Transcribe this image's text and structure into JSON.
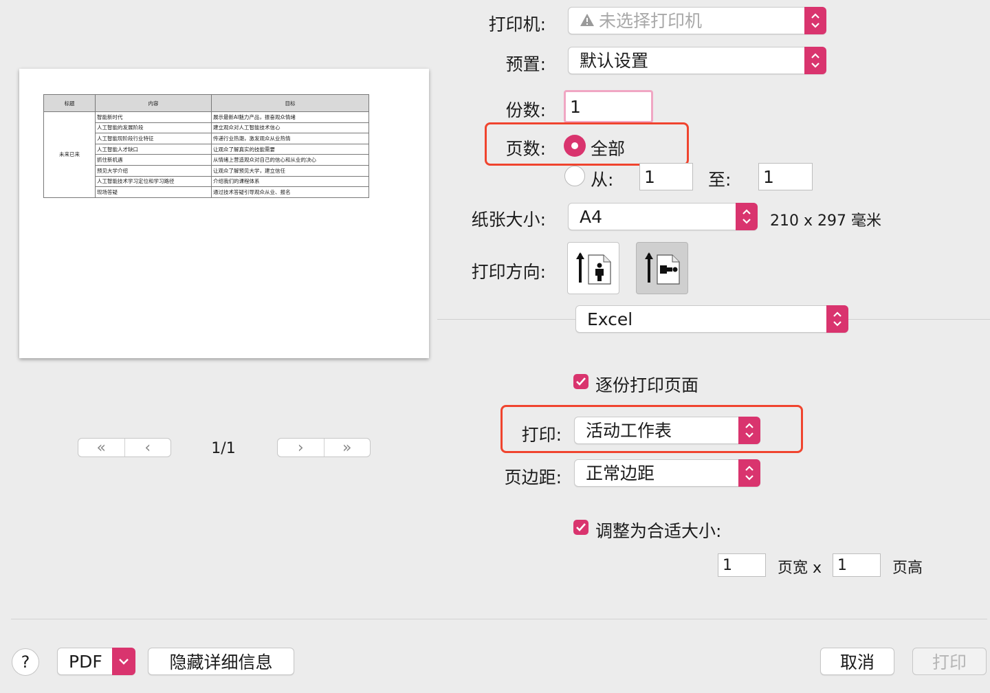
{
  "printer": {
    "label": "打印机:",
    "value": "未选择打印机"
  },
  "preset": {
    "label": "预置:",
    "value": "默认设置"
  },
  "copies": {
    "label": "份数:",
    "value": "1"
  },
  "pages": {
    "label": "页数:",
    "all_label": "全部",
    "from_label": "从:",
    "from_value": "1",
    "to_label": "至:",
    "to_value": "1"
  },
  "paper": {
    "label": "纸张大小:",
    "value": "A4",
    "dims": "210 x 297 毫米"
  },
  "orientation": {
    "label": "打印方向:",
    "selected": "portrait"
  },
  "app_menu": {
    "value": "Excel"
  },
  "collate": {
    "label": "逐份打印页面",
    "checked": true
  },
  "print_what": {
    "label": "打印:",
    "value": "活动工作表"
  },
  "margins": {
    "label": "页边距:",
    "value": "正常边距"
  },
  "fit": {
    "label": "调整为合适大小:",
    "checked": true,
    "width_value": "1",
    "width_label": "页宽 x",
    "height_value": "1",
    "height_label": "页高"
  },
  "preview": {
    "page_indicator": "1/1",
    "table": {
      "headers": [
        "标题",
        "内容",
        "目标"
      ],
      "merged_title": "未来已来",
      "rows": [
        [
          "智能新时代",
          "展示最新AI魅力产品，振奋观众情绪"
        ],
        [
          "人工智能的发展阶段",
          "建立观众对人工智能技术信心"
        ],
        [
          "人工智能现阶段行业特征",
          "传递行业热潮，激发观众从业热情"
        ],
        [
          "人工智能人才缺口",
          "让观众了解真实的技能需要"
        ],
        [
          "抓住新机遇",
          "从情绪上营造观众对自己的信心和从业的决心"
        ],
        [
          "预见大学介绍",
          "让观众了解预见大学，建立信任"
        ],
        [
          "人工智能技术学习定位和学习路径",
          "介绍我们的课程体系"
        ],
        [
          "现场答疑",
          "通过技术答疑引导观众从业、报名"
        ]
      ]
    }
  },
  "footer": {
    "help": "?",
    "pdf": "PDF",
    "hide_details": "隐藏详细信息",
    "cancel": "取消",
    "print": "打印"
  },
  "colors": {
    "accent": "#d9346e",
    "highlight": "#f0442e",
    "background": "#ececec"
  }
}
